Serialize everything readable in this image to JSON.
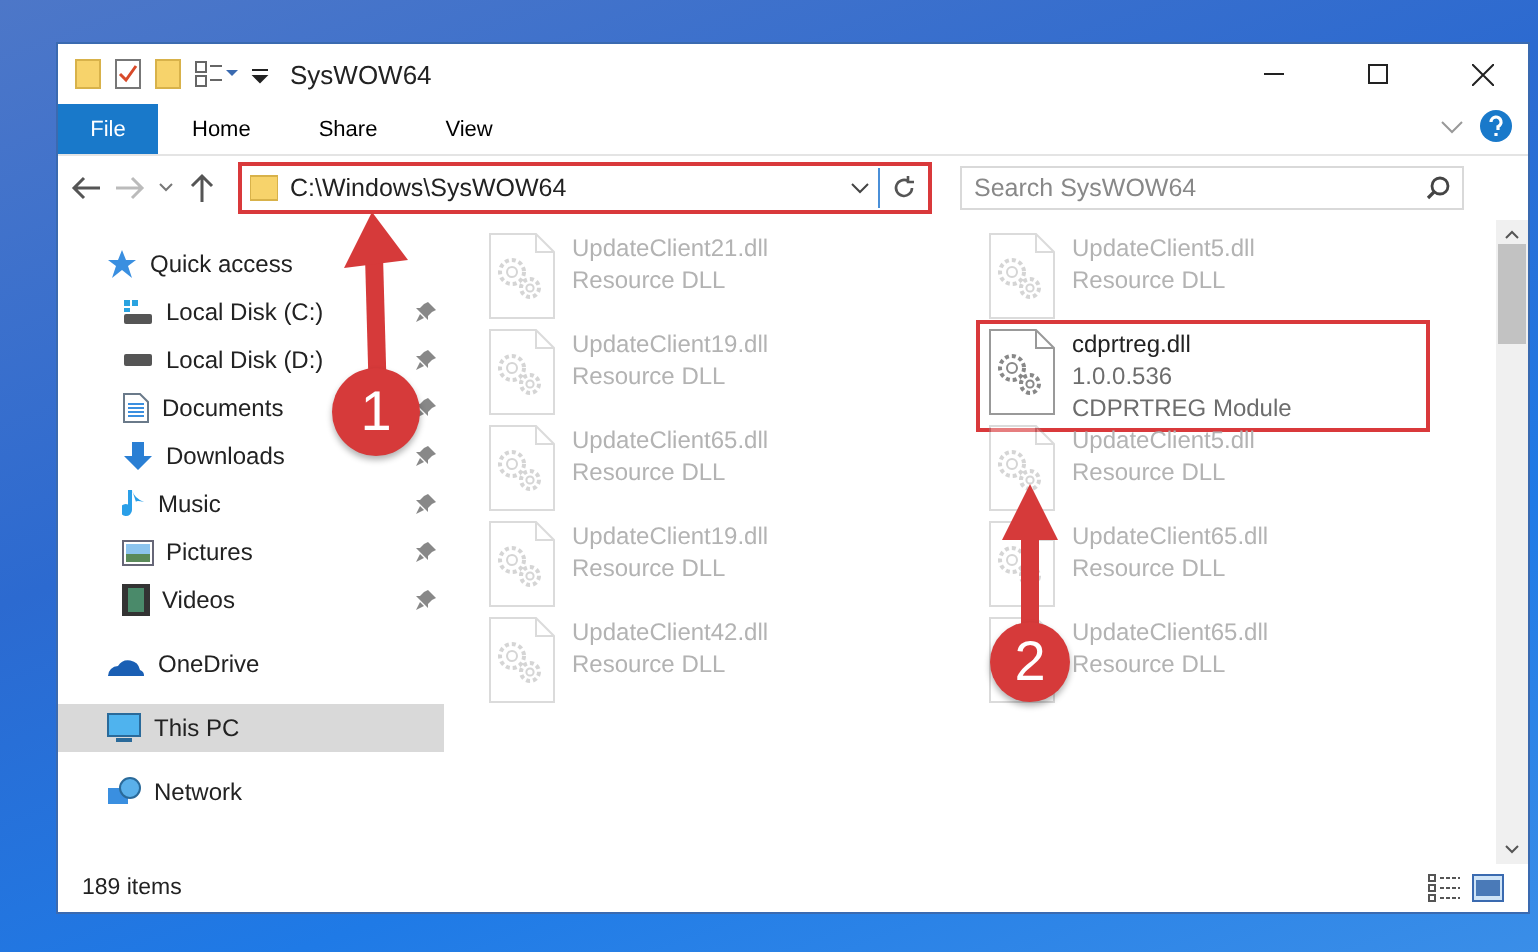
{
  "window": {
    "title": "SysWOW64"
  },
  "ribbon_tabs": [
    {
      "label": "File",
      "kind": "file"
    },
    {
      "label": "Home",
      "kind": "tab"
    },
    {
      "label": "Share",
      "kind": "tab"
    },
    {
      "label": "View",
      "kind": "tab"
    }
  ],
  "address": {
    "path": "C:\\Windows\\SysWOW64",
    "highlighted": true
  },
  "search": {
    "placeholder": "Search SysWOW64"
  },
  "sidebar": {
    "items": [
      {
        "label": "Quick access",
        "kind": "star",
        "selected": false,
        "children": [
          {
            "label": "Local Disk (C:)",
            "kind": "drive-system",
            "pinned": true
          },
          {
            "label": "Local Disk (D:)",
            "kind": "drive",
            "pinned": true
          },
          {
            "label": "Documents",
            "kind": "documents",
            "pinned": true
          },
          {
            "label": "Downloads",
            "kind": "downloads",
            "pinned": true
          },
          {
            "label": "Music",
            "kind": "music",
            "pinned": true
          },
          {
            "label": "Pictures",
            "kind": "pictures",
            "pinned": true
          },
          {
            "label": "Videos",
            "kind": "videos",
            "pinned": true
          }
        ]
      },
      {
        "label": "OneDrive",
        "kind": "cloud",
        "selected": false
      },
      {
        "label": "This PC",
        "kind": "pc",
        "selected": true
      },
      {
        "label": "Network",
        "kind": "network",
        "selected": false
      }
    ]
  },
  "files": [
    {
      "name": "UpdateClient21.dll",
      "lines": [
        "Resource DLL"
      ],
      "faded": true,
      "highlighted": false
    },
    {
      "name": "UpdateClient5.dll",
      "lines": [
        "Resource DLL"
      ],
      "faded": true,
      "highlighted": false
    },
    {
      "name": "UpdateClient19.dll",
      "lines": [
        "Resource DLL"
      ],
      "faded": true,
      "highlighted": false
    },
    {
      "name": "cdprtreg.dll",
      "lines": [
        "1.0.0.536",
        "CDPRTREG Module"
      ],
      "faded": false,
      "highlighted": true
    },
    {
      "name": "UpdateClient65.dll",
      "lines": [
        "Resource DLL"
      ],
      "faded": true,
      "highlighted": false
    },
    {
      "name": "UpdateClient5.dll",
      "lines": [
        "Resource DLL"
      ],
      "faded": true,
      "highlighted": false
    },
    {
      "name": "UpdateClient19.dll",
      "lines": [
        "Resource DLL"
      ],
      "faded": true,
      "highlighted": false
    },
    {
      "name": "UpdateClient65.dll",
      "lines": [
        "Resource DLL"
      ],
      "faded": true,
      "highlighted": false
    },
    {
      "name": "UpdateClient42.dll",
      "lines": [
        "Resource DLL"
      ],
      "faded": true,
      "highlighted": false
    },
    {
      "name": "UpdateClient65.dll",
      "lines": [
        "Resource DLL"
      ],
      "faded": true,
      "highlighted": false
    }
  ],
  "status_bar": {
    "count": "189 items"
  },
  "annotations": [
    {
      "number": "1"
    },
    {
      "number": "2"
    }
  ]
}
